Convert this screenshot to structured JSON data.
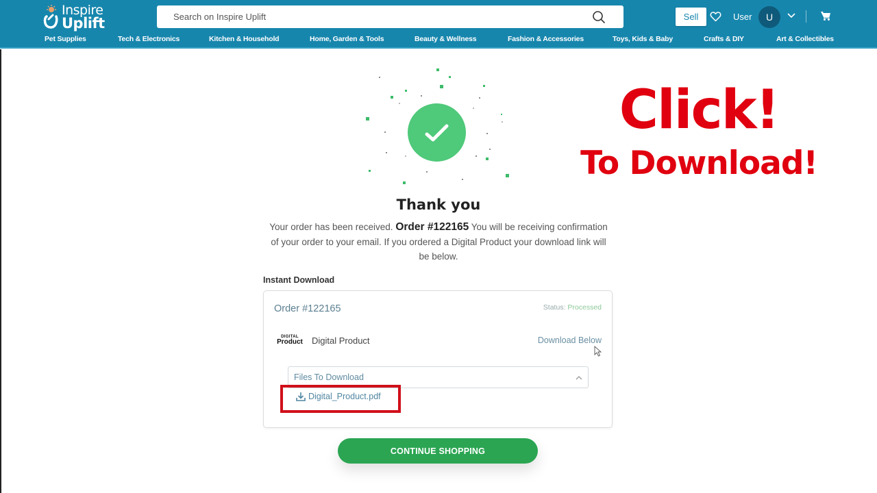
{
  "header": {
    "logo": {
      "line1": "Inspire",
      "line2": "Uplift"
    },
    "search": {
      "placeholder": "Search on Inspire Uplift",
      "value": ""
    },
    "sell_label": "Sell",
    "user_label": "User",
    "avatar_initial": "U",
    "categories": [
      "Pet Supplies",
      "Tech & Electronics",
      "Kitchen & Household",
      "Home, Garden & Tools",
      "Beauty & Wellness",
      "Fashion & Accessories",
      "Toys, Kids & Baby",
      "Crafts & DIY",
      "Art & Collectibles"
    ]
  },
  "confirmation": {
    "title": "Thank you",
    "message_before": "Your order has been received.",
    "order_strong": "Order #122165",
    "message_after": "You will be receiving confirmation of your order to your email. If you ordered a Digital Product your download link will be below."
  },
  "instant_download": {
    "section_label": "Instant Download",
    "order_number": "Order #122165",
    "status_label": "Status:",
    "status_value": "Processed",
    "product_thumb_line1": "DIGITAL",
    "product_thumb_line2": "Product",
    "product_name": "Digital Product",
    "download_note": "Download Below",
    "files_accordion_label": "Files To Download",
    "files": [
      {
        "name": "Digital_Product.pdf"
      }
    ]
  },
  "continue_label": "CONTINUE SHOPPING",
  "overlay": {
    "line1": "Click!",
    "line2": "To Download!"
  },
  "colors": {
    "header_bg": "#1786ad",
    "success_green": "#4fc97a",
    "button_green": "#2ba552",
    "highlight_red": "#d0101a",
    "promo_red": "#e0000f"
  }
}
